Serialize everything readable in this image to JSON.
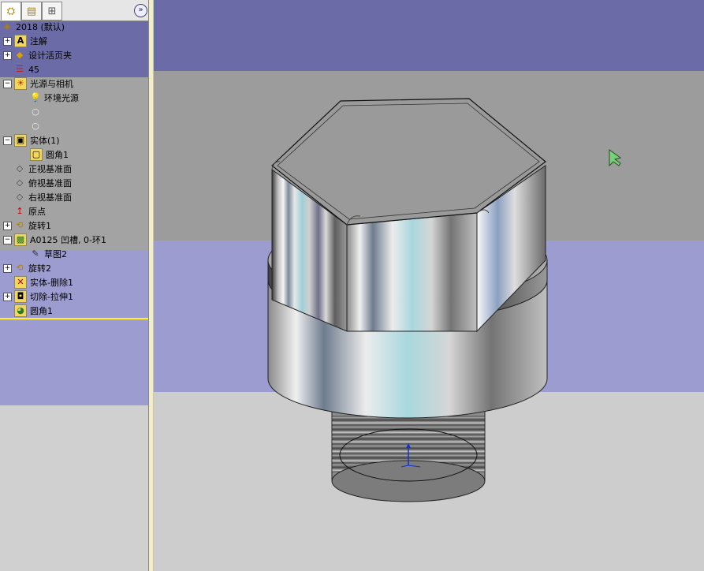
{
  "tabs": [
    {
      "name": "featuremanager-tab",
      "icon": "tree-icon"
    },
    {
      "name": "propertymanager-tab",
      "icon": "property-icon"
    },
    {
      "name": "configuration-tab",
      "icon": "config-icon"
    }
  ],
  "tree": {
    "root": "2018  (默认)",
    "items": [
      {
        "label": "注解",
        "icon": "annotation-icon",
        "expander": "+"
      },
      {
        "label": "设计活页夹",
        "icon": "binder-icon",
        "expander": "+"
      },
      {
        "label": "45",
        "icon": "material-icon",
        "expander": ""
      },
      {
        "label": "光源与相机",
        "icon": "lights-icon",
        "expander": "−"
      },
      {
        "label": "环境光源",
        "icon": "bulb-icon",
        "expander": ""
      },
      {
        "label": "实体(1)",
        "icon": "solid-bodies-icon",
        "expander": "−"
      },
      {
        "label": "圆角1",
        "icon": "body-icon",
        "expander": ""
      },
      {
        "label": "正视基准面",
        "icon": "plane-icon",
        "expander": ""
      },
      {
        "label": "俯视基准面",
        "icon": "plane-icon",
        "expander": ""
      },
      {
        "label": "右视基准面",
        "icon": "plane-icon",
        "expander": ""
      },
      {
        "label": "原点",
        "icon": "origin-icon",
        "expander": ""
      },
      {
        "label": "旋转1",
        "icon": "revolve-icon",
        "expander": "+"
      },
      {
        "label": "A0125 凹槽, 0-环1",
        "icon": "groove-icon",
        "expander": "−"
      },
      {
        "label": "草图2",
        "icon": "sketch-icon",
        "expander": ""
      },
      {
        "label": "旋转2",
        "icon": "revolve-icon",
        "expander": "+"
      },
      {
        "label": "实体-删除1",
        "icon": "delete-body-icon",
        "expander": ""
      },
      {
        "label": "切除-拉伸1",
        "icon": "cut-extrude-icon",
        "expander": "+"
      },
      {
        "label": "圆角1",
        "icon": "fillet-icon",
        "expander": ""
      }
    ]
  },
  "colors": {
    "band_top": "#6b6ba8",
    "band_gray": "#9c9c9c",
    "band_lilac": "#9c9cd0",
    "band_floor": "#cdcdcd",
    "rollback_bar": "#e5d000"
  }
}
